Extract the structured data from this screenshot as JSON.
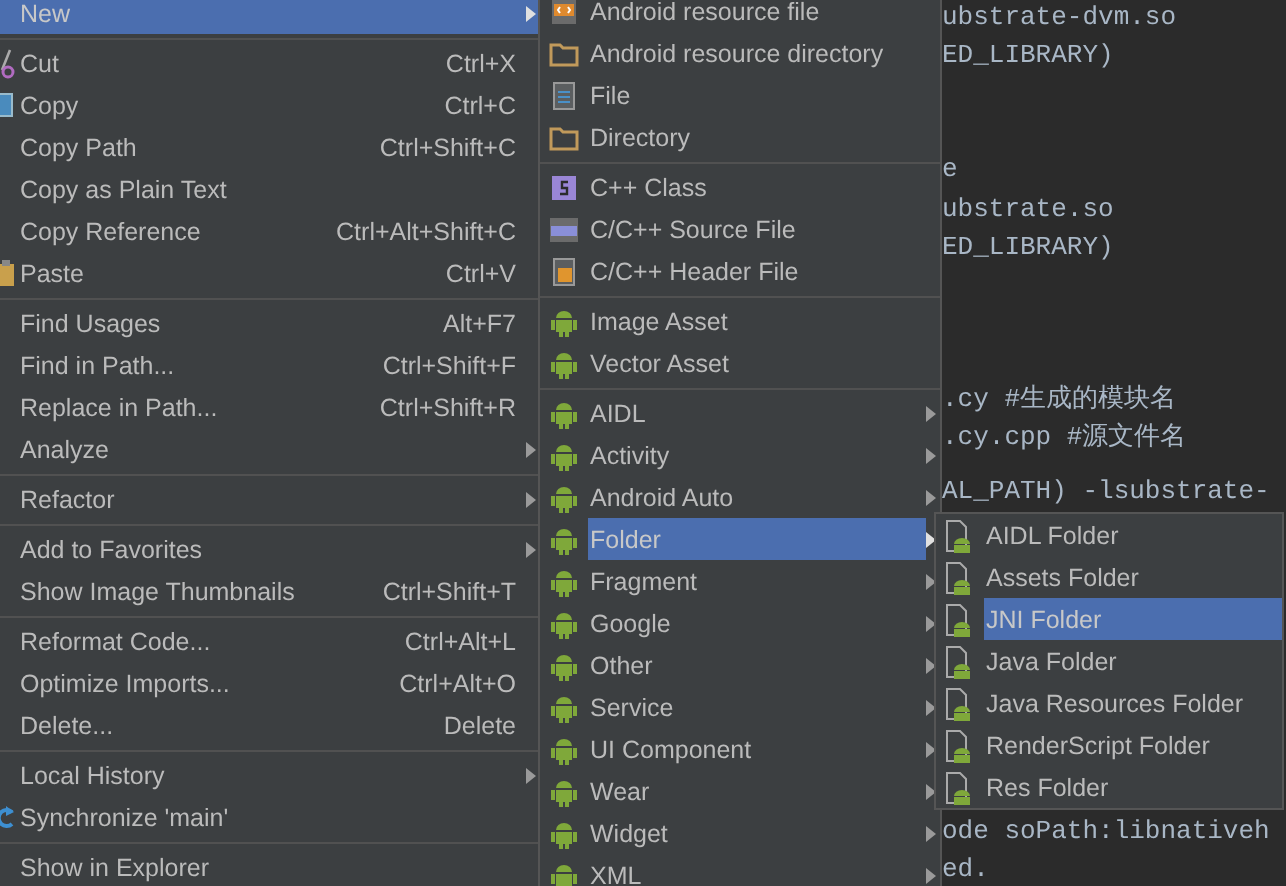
{
  "editor": {
    "lines": [
      {
        "text": "ubstrate-dvm.so"
      },
      {
        "text": "ED_LIBRARY)"
      },
      {
        "text": "e"
      },
      {
        "text": "ubstrate.so"
      },
      {
        "text": "ED_LIBRARY)"
      },
      {
        "text": ".cy #生成的模块名"
      },
      {
        "text": ".cy.cpp #源文件名"
      },
      {
        "text": "AL_PATH) -lsubstrate-"
      },
      {
        "text": "ode soPath:libnativeh"
      },
      {
        "text": "ed."
      }
    ]
  },
  "context_menu": {
    "groups": [
      [
        {
          "label": "New",
          "selected": true,
          "submenu": true
        }
      ],
      [
        {
          "label": "Cut",
          "shortcut": "Ctrl+X",
          "kind": "scissors",
          "selected": false,
          "submenu": false
        },
        {
          "label": "Copy",
          "shortcut": "Ctrl+C",
          "kind": "copy",
          "selected": false,
          "submenu": false
        },
        {
          "label": "Copy Path",
          "shortcut": "Ctrl+Shift+C",
          "selected": false,
          "submenu": false
        },
        {
          "label": "Copy as Plain Text",
          "selected": false,
          "submenu": false
        },
        {
          "label": "Copy Reference",
          "shortcut": "Ctrl+Alt+Shift+C",
          "selected": false,
          "submenu": false
        },
        {
          "label": "Paste",
          "shortcut": "Ctrl+V",
          "kind": "paste",
          "selected": false,
          "submenu": false
        }
      ],
      [
        {
          "label": "Find Usages",
          "shortcut": "Alt+F7",
          "selected": false,
          "submenu": false
        },
        {
          "label": "Find in Path...",
          "shortcut": "Ctrl+Shift+F",
          "selected": false,
          "submenu": false
        },
        {
          "label": "Replace in Path...",
          "shortcut": "Ctrl+Shift+R",
          "selected": false,
          "submenu": false
        },
        {
          "label": "Analyze",
          "selected": false,
          "submenu": true
        }
      ],
      [
        {
          "label": "Refactor",
          "selected": false,
          "submenu": true
        }
      ],
      [
        {
          "label": "Add to Favorites",
          "selected": false,
          "submenu": true
        },
        {
          "label": "Show Image Thumbnails",
          "shortcut": "Ctrl+Shift+T",
          "selected": false,
          "submenu": false
        }
      ],
      [
        {
          "label": "Reformat Code...",
          "shortcut": "Ctrl+Alt+L",
          "selected": false,
          "submenu": false
        },
        {
          "label": "Optimize Imports...",
          "shortcut": "Ctrl+Alt+O",
          "selected": false,
          "submenu": false
        },
        {
          "label": "Delete...",
          "shortcut": "Delete",
          "selected": false,
          "submenu": false
        }
      ],
      [
        {
          "label": "Local History",
          "selected": false,
          "submenu": true
        },
        {
          "label": "Synchronize 'main'",
          "kind": "sync",
          "selected": false,
          "submenu": false
        }
      ],
      [
        {
          "label": "Show in Explorer",
          "selected": false,
          "submenu": false
        }
      ]
    ]
  },
  "new_submenu": {
    "groups": [
      [
        {
          "label": "Android resource file",
          "kind": "resource",
          "selected": false,
          "submenu": false
        },
        {
          "label": "Android resource directory",
          "kind": "folder",
          "selected": false,
          "submenu": false
        },
        {
          "label": "File",
          "kind": "file",
          "selected": false,
          "submenu": false
        },
        {
          "label": "Directory",
          "kind": "folder",
          "selected": false,
          "submenu": false
        }
      ],
      [
        {
          "label": "C++ Class",
          "kind": "class",
          "selected": false,
          "submenu": false
        },
        {
          "label": "C/C++ Source File",
          "kind": "source",
          "selected": false,
          "submenu": false
        },
        {
          "label": "C/C++ Header File",
          "kind": "header",
          "selected": false,
          "submenu": false
        }
      ],
      [
        {
          "label": "Image Asset",
          "kind": "android",
          "selected": false,
          "submenu": false
        },
        {
          "label": "Vector Asset",
          "kind": "android",
          "selected": false,
          "submenu": false
        }
      ],
      [
        {
          "label": "AIDL",
          "kind": "android",
          "selected": false,
          "submenu": true
        },
        {
          "label": "Activity",
          "kind": "android",
          "selected": false,
          "submenu": true
        },
        {
          "label": "Android Auto",
          "kind": "android",
          "selected": false,
          "submenu": true
        },
        {
          "label": "Folder",
          "kind": "android",
          "selected": true,
          "submenu": true
        },
        {
          "label": "Fragment",
          "kind": "android",
          "selected": false,
          "submenu": true
        },
        {
          "label": "Google",
          "kind": "android",
          "selected": false,
          "submenu": true
        },
        {
          "label": "Other",
          "kind": "android",
          "selected": false,
          "submenu": true
        },
        {
          "label": "Service",
          "kind": "android",
          "selected": false,
          "submenu": true
        },
        {
          "label": "UI Component",
          "kind": "android",
          "selected": false,
          "submenu": true
        },
        {
          "label": "Wear",
          "kind": "android",
          "selected": false,
          "submenu": true
        },
        {
          "label": "Widget",
          "kind": "android",
          "selected": false,
          "submenu": true
        },
        {
          "label": "XML",
          "kind": "android",
          "selected": false,
          "submenu": true
        }
      ]
    ]
  },
  "folder_submenu": {
    "groups": [
      [
        {
          "label": "AIDL Folder",
          "kind": "androidfolder",
          "selected": false,
          "submenu": false
        },
        {
          "label": "Assets Folder",
          "kind": "androidfolder",
          "selected": false,
          "submenu": false
        },
        {
          "label": "JNI Folder",
          "kind": "androidfolder",
          "selected": true,
          "submenu": false
        },
        {
          "label": "Java Folder",
          "kind": "androidfolder",
          "selected": false,
          "submenu": false
        },
        {
          "label": "Java Resources Folder",
          "kind": "androidfolder",
          "selected": false,
          "submenu": false
        },
        {
          "label": "RenderScript Folder",
          "kind": "androidfolder",
          "selected": false,
          "submenu": false
        },
        {
          "label": "Res Folder",
          "kind": "androidfolder",
          "selected": false,
          "submenu": false
        }
      ]
    ]
  }
}
